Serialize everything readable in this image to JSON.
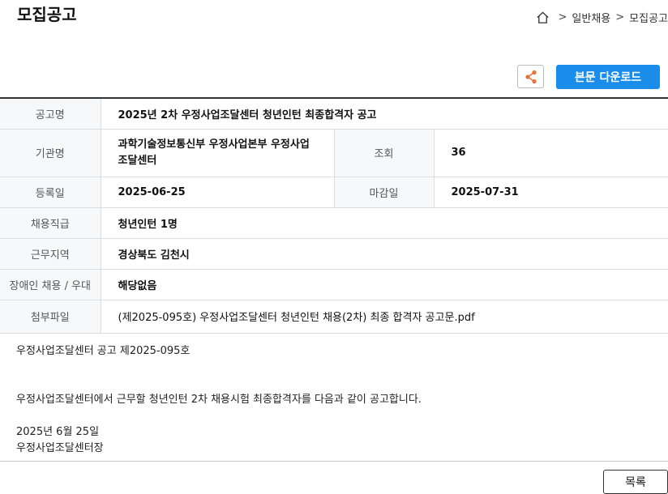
{
  "header": {
    "title": "모집공고",
    "breadcrumb": [
      ">",
      "일반채용",
      ">",
      "모집공고"
    ]
  },
  "actions": {
    "download_label": "본문 다운로드",
    "share_icon": "share-icon"
  },
  "info": {
    "notice_name_label": "공고명",
    "notice_name": "2025년 2차 우정사업조달센터 청년인턴 최종합격자 공고",
    "org_label": "기관명",
    "org_line1": "과학기술정보통신부 우정사업본부 우정사업",
    "org_line2": "조달센터",
    "views_label": "조회",
    "views": "36",
    "reg_date_label": "등록일",
    "reg_date": "2025-06-25",
    "deadline_label": "마감일",
    "deadline": "2025-07-31",
    "position_label": "채용직급",
    "position": "청년인턴 1명",
    "location_label": "근무지역",
    "location": "경상북도 김천시",
    "disability_label": "장애인 채용 / 우대",
    "disability": "해당없음",
    "attachment_label": "첨부파일",
    "attachment": "(제2025-095호) 우정사업조달센터 청년인턴 채용(2차) 최종 합격자 공고문.pdf"
  },
  "body": {
    "line1": "우정사업조달센터 공고 제2025-095호",
    "line2": "우정사업조달센터에서 근무할 청년인턴 2차 채용시험 최종합격자를 다음과 같이 공고합니다.",
    "line3": "2025년 6월 25일",
    "line4": "우정사업조달센터장"
  },
  "footer": {
    "list_label": "목록"
  },
  "colors": {
    "accent": "#1a8cea",
    "share_icon": "#e8733a"
  }
}
